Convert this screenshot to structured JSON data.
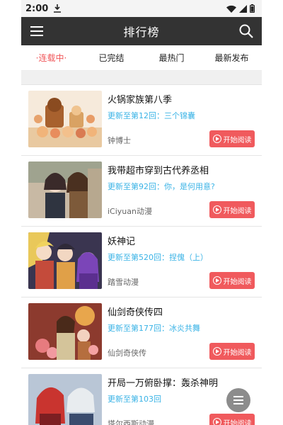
{
  "status_bar": {
    "time": "2:00"
  },
  "header": {
    "title": "排行榜"
  },
  "tabs": [
    {
      "label": "·连载中·"
    },
    {
      "label": "已完结"
    },
    {
      "label": "最热门"
    },
    {
      "label": "最新发布"
    }
  ],
  "colors": {
    "accent": "#f0575a",
    "appbar": "#333333",
    "update_text": "#3ab3e6"
  },
  "comics": [
    {
      "title": "火锅家族第八季",
      "update": "更新至第12回：三个锦囊",
      "author": "钟博士",
      "button": "开始阅读"
    },
    {
      "title": "我带超市穿到古代养丞相",
      "update": "更新至第92回：你，是何用意?",
      "author": "iCiyuan动漫",
      "button": "开始阅读"
    },
    {
      "title": "妖神记",
      "update": "更新至第520回：捏傀（上）",
      "author": "踏雪动漫",
      "button": "开始阅读"
    },
    {
      "title": "仙剑奇侠传四",
      "update": "更新至第177回：冰炎共舞",
      "author": "仙剑奇侠传",
      "button": "开始阅读"
    },
    {
      "title": "开局一万俯卧撑：轰杀神明",
      "update": "更新至第103回",
      "author": "塔尔西斯动漫",
      "button": "开始阅读"
    }
  ]
}
